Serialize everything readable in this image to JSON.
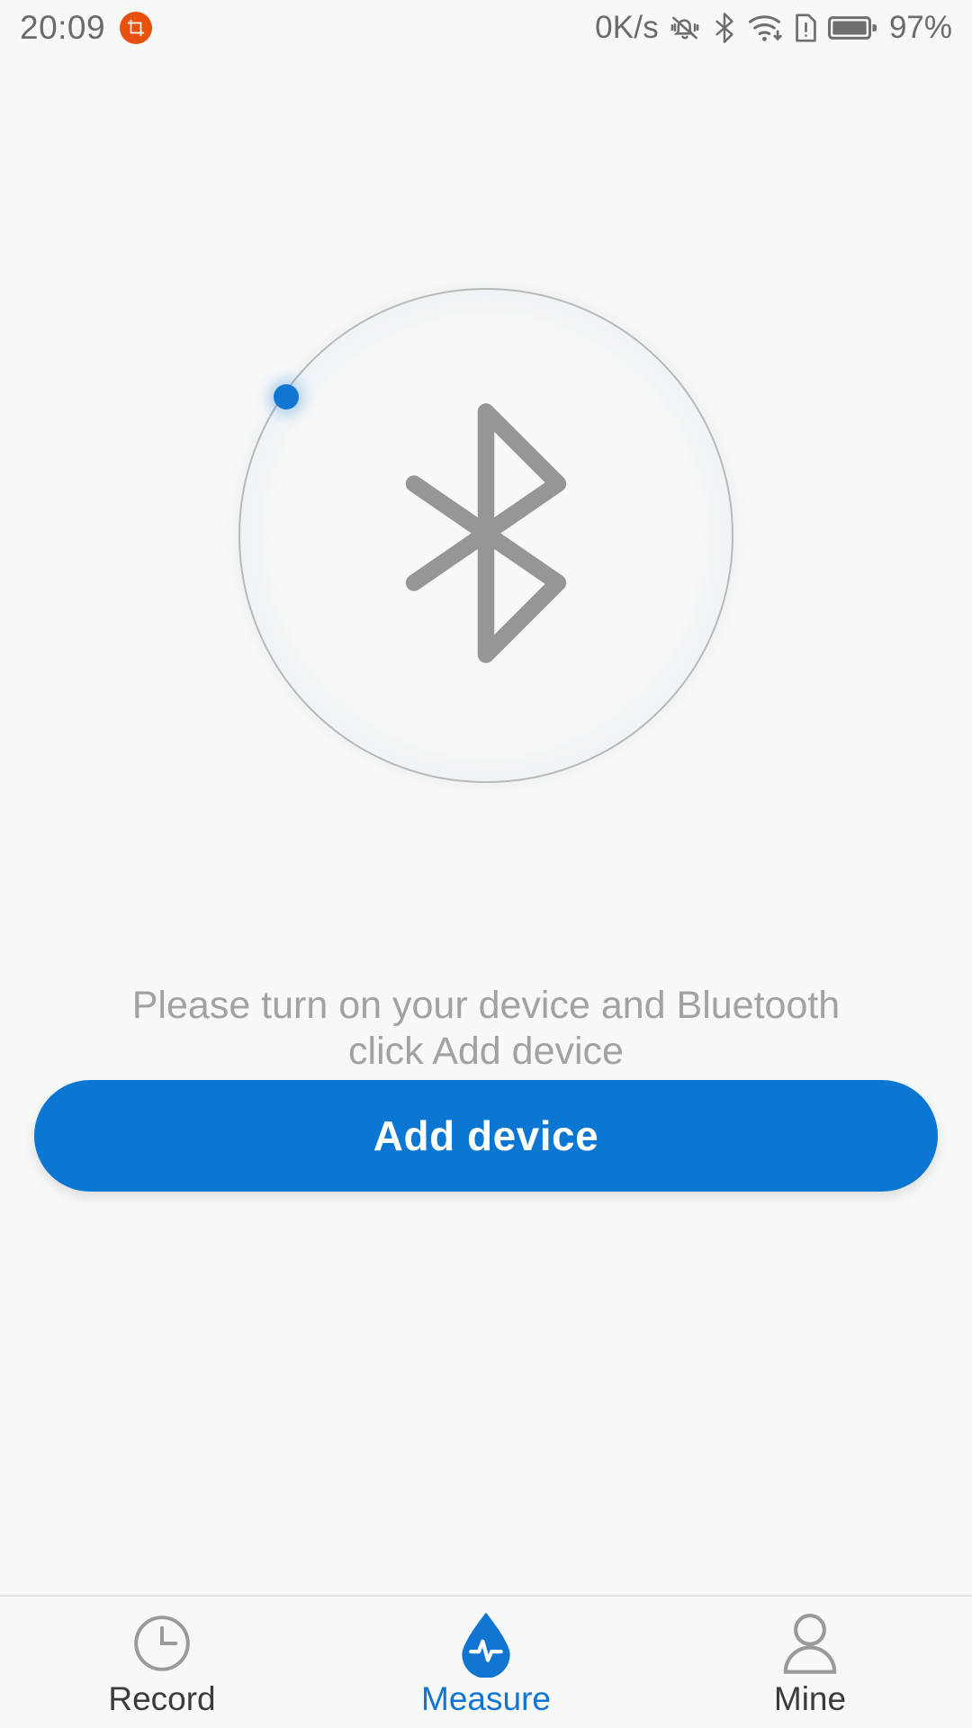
{
  "status_bar": {
    "time": "20:09",
    "screenshot_badge_icon": "crop-icon",
    "network_speed": "0K/s",
    "silent_icon": "bell-muted-icon",
    "bluetooth_icon": "bluetooth-icon",
    "wifi_icon": "wifi-download-icon",
    "sim_icon": "sim-alert-icon",
    "battery_icon": "battery-full-icon",
    "battery_percent": "97%",
    "badge_color": "#e8500f",
    "text_color": "#6b6b6b"
  },
  "main": {
    "bluetooth_ring": {
      "icon": "bluetooth-glyph",
      "ring_color": "#b9b9b9",
      "glyph_color": "#949494",
      "indicator_dot_color": "#1175d2",
      "glow_color": "#c7def2"
    },
    "hint_line_1": "Please turn on your device and Bluetooth",
    "hint_line_2": "click Add device",
    "hint_color": "#a0a2a4",
    "add_device_button": {
      "label": "Add device",
      "background": "#0c77d2",
      "text_color": "#ffffff"
    }
  },
  "tab_bar": {
    "active_color": "#1175d2",
    "inactive_color": "#3b3b3b",
    "items": [
      {
        "label": "Record",
        "icon": "clock-icon",
        "active": false
      },
      {
        "label": "Measure",
        "icon": "blood-drop-pulse-icon",
        "active": true
      },
      {
        "label": "Mine",
        "icon": "person-icon",
        "active": false
      }
    ]
  }
}
